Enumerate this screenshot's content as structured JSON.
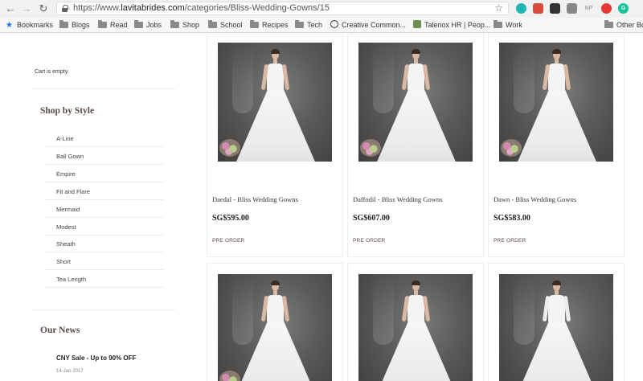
{
  "browser": {
    "url_prefix": "https://www.",
    "url_host": "lavitabrides.com",
    "url_path": "/categories/Bliss-Wedding-Gowns/15",
    "extensions": [
      {
        "icon": "teal-circle-icon",
        "color": "#1fb6b4",
        "label": ""
      },
      {
        "icon": "red-video-icon",
        "color": "#d84a3a",
        "label": ""
      },
      {
        "icon": "dark-tile-icon",
        "color": "#333333",
        "label": ""
      },
      {
        "icon": "pocket-icon",
        "color": "#888888",
        "label": ""
      },
      {
        "icon": "np-icon",
        "color": "#bbbbbb",
        "label": "NP"
      },
      {
        "icon": "red-shield-icon",
        "color": "#e53935",
        "label": ""
      },
      {
        "icon": "grammarly-icon",
        "color": "#15c39a",
        "label": "G"
      }
    ],
    "bookmarks": [
      {
        "label": "Bookmarks",
        "icon": "star-icon"
      },
      {
        "label": "Blogs",
        "icon": "folder-icon"
      },
      {
        "label": "Read",
        "icon": "folder-icon"
      },
      {
        "label": "Jobs",
        "icon": "folder-icon"
      },
      {
        "label": "Shop",
        "icon": "folder-icon"
      },
      {
        "label": "School",
        "icon": "folder-icon"
      },
      {
        "label": "Recipes",
        "icon": "folder-icon"
      },
      {
        "label": "Tech",
        "icon": "folder-icon"
      },
      {
        "label": "Creative Common...",
        "icon": "cc-icon"
      },
      {
        "label": "Talenox HR | Peop...",
        "icon": "talenox-icon"
      },
      {
        "label": "Work",
        "icon": "folder-icon"
      },
      {
        "label": "Other Bo",
        "icon": "folder-icon"
      }
    ]
  },
  "sidebar": {
    "cart_text": "Cart is empty.",
    "shop_by_style_title": "Shop by Style",
    "styles": [
      "A-Line",
      "Ball Gown",
      "Empire",
      "Fit and Flare",
      "Mermaid",
      "Modest",
      "Sheath",
      "Short",
      "Tea Length"
    ],
    "news_title": "Our News",
    "news_item_title": "CNY Sale - Up to 90% OFF",
    "news_item_date": "14-Jan-2017"
  },
  "products": [
    {
      "name": "Daedal - Bliss Wedding Gowns",
      "price": "SG$595.00",
      "status": "PRE ORDER"
    },
    {
      "name": "Daffodil - Bliss Wedding Gowns",
      "price": "SG$607.00",
      "status": "PRE ORDER"
    },
    {
      "name": "Dawn - Bliss Wedding Gowns",
      "price": "SG$583.00",
      "status": "PRE ORDER"
    }
  ]
}
